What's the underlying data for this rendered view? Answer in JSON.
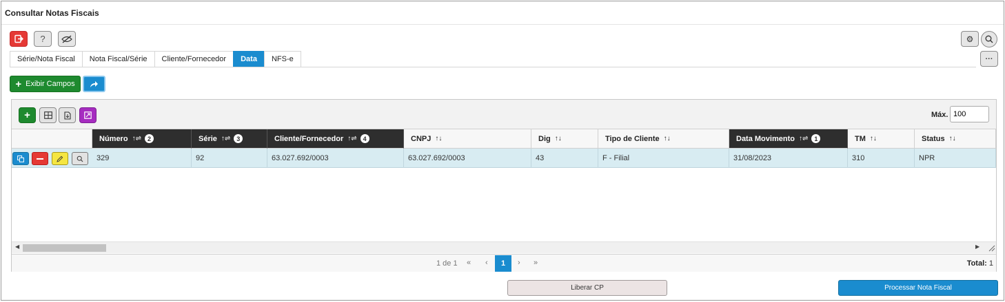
{
  "window": {
    "title": "Consultar Notas Fiscais"
  },
  "toolbar": {
    "exit_icon": "exit-icon",
    "help_label": "?",
    "hide_icon": "eye-slash-icon"
  },
  "tabs": [
    {
      "label": "Série/Nota Fiscal",
      "active": false
    },
    {
      "label": "Nota Fiscal/Série",
      "active": false
    },
    {
      "label": "Cliente/Fornecedor",
      "active": false
    },
    {
      "label": "Data",
      "active": true
    },
    {
      "label": "NFS-e",
      "active": false
    }
  ],
  "actions": {
    "exibir_campos_label": "Exibir Campos",
    "more_label": "···"
  },
  "grid": {
    "max_label": "Máx.",
    "max_value": "100",
    "columns": [
      {
        "label": "Número",
        "sort_badge": "2",
        "sort_icon": "↑⇌",
        "sorted": true
      },
      {
        "label": "Série",
        "sort_badge": "3",
        "sort_icon": "↑⇌",
        "sorted": true
      },
      {
        "label": "Cliente/Fornecedor",
        "sort_badge": "4",
        "sort_icon": "↑⇌",
        "sorted": true
      },
      {
        "label": "CNPJ",
        "sort_badge": "",
        "sort_icon": "↑↓",
        "sorted": false
      },
      {
        "label": "Dig",
        "sort_badge": "",
        "sort_icon": "↑↓",
        "sorted": false
      },
      {
        "label": "Tipo de Cliente",
        "sort_badge": "",
        "sort_icon": "↑↓",
        "sorted": false
      },
      {
        "label": "Data Movimento",
        "sort_badge": "1",
        "sort_icon": "↑⇌",
        "sorted": true
      },
      {
        "label": "TM",
        "sort_badge": "",
        "sort_icon": "↑↓",
        "sorted": false
      },
      {
        "label": "Status",
        "sort_badge": "",
        "sort_icon": "↑↓",
        "sorted": false
      }
    ],
    "rows": [
      [
        "329",
        "92",
        "63.027.692/0003",
        "63.027.692/0003",
        "43",
        "F - Filial",
        "31/08/2023",
        "310",
        "NPR"
      ]
    ]
  },
  "pager": {
    "info": "1 de 1",
    "first": "«",
    "prev": "‹",
    "current": "1",
    "next": "›",
    "last": "»",
    "total_label": "Total:",
    "total_value": "1"
  },
  "footer": {
    "liberar_label": "Liberar CP",
    "processar_label": "Processar Nota Fiscal"
  },
  "colors": {
    "accent": "#1a8ccf",
    "danger": "#e53935",
    "success": "#1e8a2f",
    "purple": "#a62cc0",
    "row_selected": "#d8ecf2",
    "header_sorted": "#2e2e2e"
  }
}
